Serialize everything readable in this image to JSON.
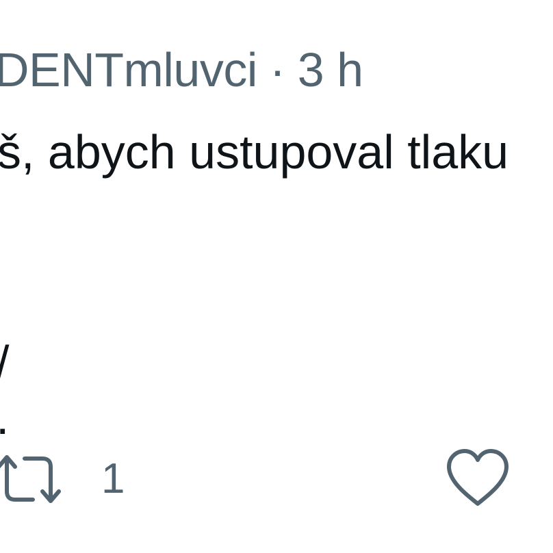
{
  "tweet": {
    "handle": "DENTmluvci",
    "separator": "·",
    "time": "3 h",
    "body_line1": "š, abych ustupoval tlaku",
    "body_fragment": "/\n."
  },
  "actions": {
    "retweet": {
      "icon": "retweet-icon",
      "count": "1",
      "color": "#536471"
    },
    "like": {
      "icon": "heart-icon",
      "color": "#536471"
    }
  }
}
